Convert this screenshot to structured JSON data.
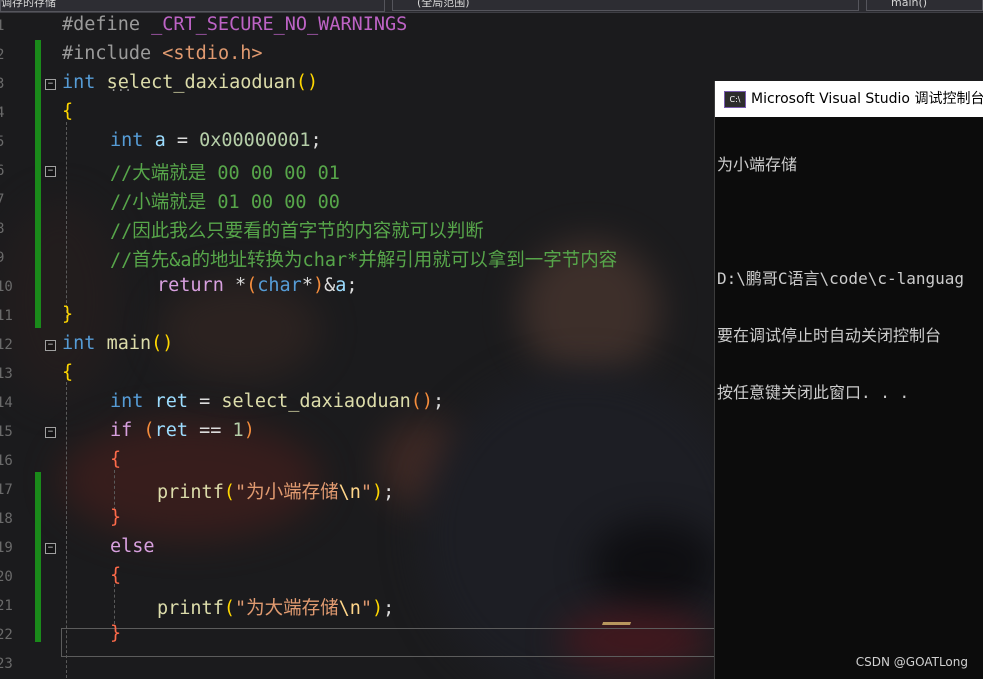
{
  "toolbar": {
    "dropdown_left": "调存的存储",
    "dropdown_mid": "(全局范围)",
    "dropdown_right": "main()"
  },
  "line_numbers": [
    "1",
    "2",
    "3",
    "4",
    "5",
    "6",
    "7",
    "8",
    "9",
    "10",
    "11",
    "12",
    "13",
    "14",
    "15",
    "16",
    "17",
    "18",
    "19",
    "20",
    "21",
    "22",
    "23"
  ],
  "code": {
    "l1_pre": "#define ",
    "l1_macro": "_CRT_SECURE_NO_WARNINGS",
    "l2_pre": "#include ",
    "l2_file": "<stdio.h>",
    "l3_kw": "int",
    "l3_fn": "select_daxiaoduan",
    "l3_paren": "()",
    "l4_brace": "{",
    "l5_kw": "int",
    "l5_var": "a",
    "l5_eq": " = ",
    "l5_num": "0x00000001",
    "l5_semi": ";",
    "l6_cmt": "//大端就是 00 00 00 01",
    "l7_cmt": "//小端就是 01 00 00 00",
    "l8_cmt": "//因此我么只要看的首字节的内容就可以判断",
    "l9_cmt": "//首先&a的地址转换为char*并解引用就可以拿到一字节内容",
    "l10_ret": "return",
    "l10_star": " *",
    "l10_lp": "(",
    "l10_kw": "char",
    "l10_star2": "*",
    "l10_rp": ")",
    "l10_amp": "&",
    "l10_var": "a",
    "l10_semi": ";",
    "l11_brace": "}",
    "l12_kw": "int",
    "l12_fn": "main",
    "l12_paren": "()",
    "l13_brace": "{",
    "l14_kw": "int",
    "l14_var": "ret",
    "l14_eq": " = ",
    "l14_fn": "select_daxiaoduan",
    "l14_paren": "()",
    "l14_semi": ";",
    "l15_if": "if",
    "l15_lp": "(",
    "l15_var": "ret",
    "l15_op": " == ",
    "l15_num": "1",
    "l15_rp": ")",
    "l16_brace": "{",
    "l17_fn": "printf",
    "l17_lp": "(",
    "l17_str": "\"为小端存储",
    "l17_esc": "\\n",
    "l17_q": "\"",
    "l17_rp": ")",
    "l17_semi": ";",
    "l18_brace": "}",
    "l19_else": "else",
    "l20_brace": "{",
    "l21_fn": "printf",
    "l21_lp": "(",
    "l21_str": "\"为大端存储",
    "l21_esc": "\\n",
    "l21_q": "\"",
    "l21_rp": ")",
    "l21_semi": ";",
    "l22_brace": "}",
    "l3_dots": "..."
  },
  "console": {
    "icon_text": "C:\\",
    "title": "Microsoft Visual Studio 调试控制台",
    "lines": [
      "为小端存储",
      "",
      "D:\\鹏哥C语言\\code\\c-languag",
      "要在调试停止时自动关闭控制台",
      "按任意键关闭此窗口. . ."
    ]
  },
  "watermark": "CSDN @GOATLong",
  "colors": {
    "keyword": "#569cd6",
    "function": "#dcdcaa",
    "comment": "#57a64a",
    "string": "#e09a70",
    "change_bar": "#1a8a1a"
  }
}
